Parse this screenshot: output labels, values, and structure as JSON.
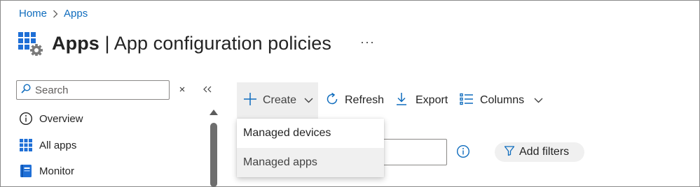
{
  "breadcrumb": {
    "home": "Home",
    "current": "Apps"
  },
  "title": {
    "bold": "Apps",
    "rest": " | App configuration policies"
  },
  "more_label": "···",
  "sidebar": {
    "search_placeholder": "Search",
    "items": [
      {
        "label": "Overview",
        "icon": "info-circle-icon"
      },
      {
        "label": "All apps",
        "icon": "grid-icon"
      },
      {
        "label": "Monitor",
        "icon": "monitor-book-icon"
      }
    ]
  },
  "toolbar": {
    "create": "Create",
    "refresh": "Refresh",
    "export": "Export",
    "columns": "Columns"
  },
  "create_menu": {
    "items": [
      "Managed devices",
      "Managed apps"
    ]
  },
  "filters": {
    "add_filters": "Add filters"
  },
  "colors": {
    "accent": "#0f6cbd",
    "brand_tile": "#1f6fd6",
    "text": "#242424"
  }
}
